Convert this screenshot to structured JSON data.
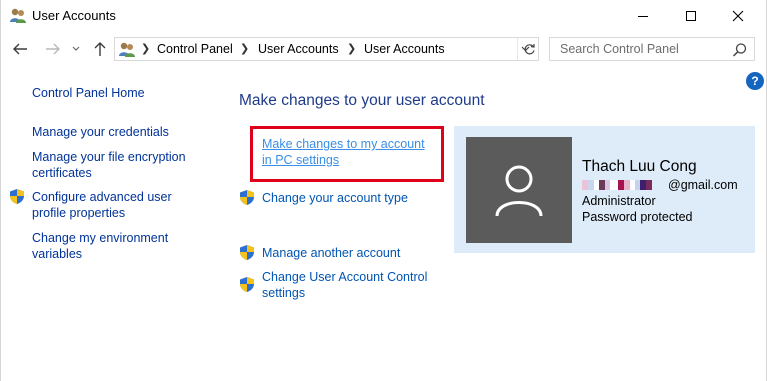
{
  "window": {
    "title": "User Accounts"
  },
  "titlebar": {
    "minimize_icon": "minimize-icon",
    "maximize_icon": "maximize-icon",
    "close_icon": "close-icon"
  },
  "address_bar": {
    "breadcrumbs": [
      "Control Panel",
      "User Accounts",
      "User Accounts"
    ],
    "search_placeholder": "Search Control Panel"
  },
  "sidebar": {
    "home": "Control Panel Home",
    "items": [
      {
        "label": "Manage your credentials"
      },
      {
        "label_line1": "Manage your file encryption",
        "label_line2": "certificates"
      },
      {
        "label_line1": "Configure advanced user",
        "label_line2": "profile properties",
        "icon": "shield-icon"
      },
      {
        "label_line1": "Change my environment",
        "label_line2": "variables"
      }
    ]
  },
  "main": {
    "heading": "Make changes to your user account",
    "links": {
      "pc_settings_line1": "Make changes to my account",
      "pc_settings_line2": "in PC settings",
      "change_type": "Change your account type",
      "manage_another": "Manage another account",
      "uac_line1": "Change User Account Control",
      "uac_line2": "settings"
    }
  },
  "account": {
    "name": "Thach Luu Cong",
    "email_suffix": "@gmail.com",
    "role": "Administrator",
    "password_status": "Password protected"
  },
  "colors": {
    "accent": "#1e3a8a",
    "link": "#0055b3",
    "highlight_box": "#e0001b",
    "card_bg": "#deecf9",
    "avatar_bg": "#5b5b5b"
  }
}
